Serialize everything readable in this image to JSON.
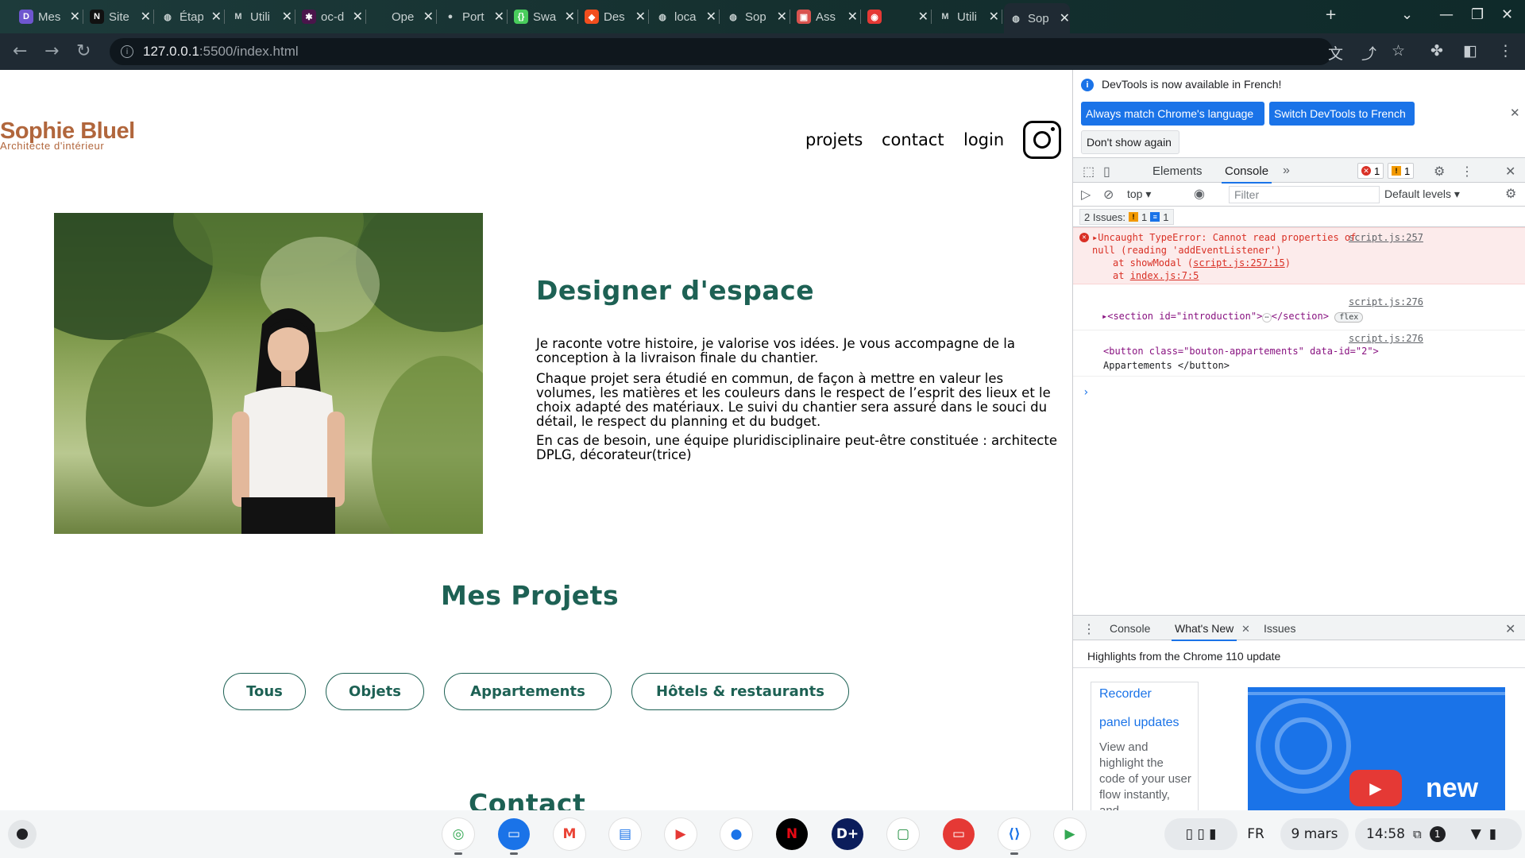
{
  "browser": {
    "tabs": [
      {
        "title": "Mes",
        "icon": "discord-like-icon",
        "color": "#6e56cf",
        "glyph": "D"
      },
      {
        "title": "Site",
        "icon": "notion-icon",
        "color": "#111111",
        "glyph": "N"
      },
      {
        "title": "Étap",
        "icon": "globe-icon",
        "color": "",
        "glyph": "◍"
      },
      {
        "title": "Utili",
        "icon": "m-logo-icon",
        "color": "",
        "glyph": "M"
      },
      {
        "title": "oc-d",
        "icon": "slack-icon",
        "color": "#4a154b",
        "glyph": "✱"
      },
      {
        "title": "Ope",
        "icon": "openai-icon",
        "color": "",
        "glyph": ""
      },
      {
        "title": "Port",
        "icon": "github-icon",
        "color": "",
        "glyph": "●"
      },
      {
        "title": "Swa",
        "icon": "swagger-icon",
        "color": "#49cc5c",
        "glyph": "{}"
      },
      {
        "title": "Des",
        "icon": "figma-icon",
        "color": "#f24e1e",
        "glyph": "◆"
      },
      {
        "title": "loca",
        "icon": "globe-icon",
        "color": "",
        "glyph": "◍"
      },
      {
        "title": "Sop",
        "icon": "globe-icon",
        "color": "",
        "glyph": "◍"
      },
      {
        "title": "Ass",
        "icon": "image-icon",
        "color": "#d9534f",
        "glyph": "▣"
      },
      {
        "title": "",
        "icon": "record-icon",
        "color": "#e53935",
        "glyph": "◉"
      },
      {
        "title": "Utili",
        "icon": "m-logo-icon",
        "color": "",
        "glyph": "M"
      },
      {
        "title": "Sop",
        "icon": "globe-icon",
        "color": "",
        "glyph": "◍"
      }
    ],
    "url_host": "127.0.0.1",
    "url_rest": ":5500/index.html"
  },
  "site": {
    "logo_name": "Sophie Bluel",
    "logo_subtitle": "Architecte d'intérieur",
    "nav": [
      "projets",
      "contact",
      "login"
    ],
    "intro_title": "Designer d'espace",
    "intro_paragraphs": [
      "Je raconte votre histoire, je valorise vos idées. Je vous accompagne de la conception à la livraison finale du chantier.",
      "Chaque projet sera étudié en commun, de façon à mettre en valeur les volumes, les matières et les couleurs dans le respect de l’esprit des lieux et le choix adapté des matériaux. Le suivi du chantier sera assuré dans le souci du détail, le respect du planning et du budget.",
      "En cas de besoin, une équipe pluridisciplinaire peut-être constituée : architecte DPLG, décorateur(trice)"
    ],
    "projects_title": "Mes Projets",
    "filters": [
      "Tous",
      "Objets",
      "Appartements",
      "Hôtels & restaurants"
    ],
    "contact_title": "Contact",
    "accent_color": "#1d6154",
    "logo_color": "#b1663c"
  },
  "devtools": {
    "notice": "DevTools is now available in French!",
    "btn_match": "Always match Chrome's language",
    "btn_switch": "Switch DevTools to French",
    "btn_dont_show": "Don't show again",
    "tabs": [
      "Elements",
      "Console"
    ],
    "error_count": "1",
    "warning_count": "1",
    "context": "top",
    "filter_placeholder": "Filter",
    "levels": "Default levels",
    "issues_label": "2 Issues:",
    "issues_warn": "1",
    "issues_info": "1",
    "error_line1": "Uncaught TypeError: Cannot read properties of",
    "error_line2": "null (reading 'addEventListener')",
    "error_at1_prefix": "at showModal (",
    "error_at1_link": "script.js:257:15",
    "error_at2_prefix": "at ",
    "error_at2_link": "index.js:7:5",
    "error_src": "script.js:257",
    "log1_src": "script.js:276",
    "log1_tag_open": "<section id=\"introduction\">",
    "log1_tag_close": "</section>",
    "log1_badge": "flex",
    "log2_src": "script.js:276",
    "log2_line1": "<button class=\"bouton-appartements\" data-id=\"2\">",
    "log2_line2": "Appartements </button>",
    "drawer_tabs": [
      "Console",
      "What's New",
      "Issues"
    ],
    "drawer_heading": "Highlights from the Chrome 110 update",
    "card_title": "Recorder",
    "card_link": "panel updates",
    "card_text": "View and highlight the code of your user flow instantly, and",
    "promo_text": "new"
  },
  "shelf": {
    "apps": [
      {
        "name": "chrome-app-icon",
        "color": "#ffffff"
      },
      {
        "name": "files-app-icon",
        "color": "#1a73e8"
      },
      {
        "name": "gmail-app-icon",
        "color": "#ffffff"
      },
      {
        "name": "docs-app-icon",
        "color": "#ffffff"
      },
      {
        "name": "youtube-app-icon",
        "color": "#ffffff"
      },
      {
        "name": "messages-app-icon",
        "color": "#ffffff"
      },
      {
        "name": "netflix-app-icon",
        "color": "#000000"
      },
      {
        "name": "disney-plus-app-icon",
        "color": "#0b1d5b"
      },
      {
        "name": "classroom-app-icon",
        "color": "#ffffff"
      },
      {
        "name": "remote-desktop-app-icon",
        "color": "#e53935"
      },
      {
        "name": "vscode-app-icon",
        "color": "#ffffff"
      },
      {
        "name": "play-store-app-icon",
        "color": "#ffffff"
      }
    ],
    "lang": "FR",
    "date": "9 mars",
    "time": "14:58",
    "notif_count": "1"
  }
}
